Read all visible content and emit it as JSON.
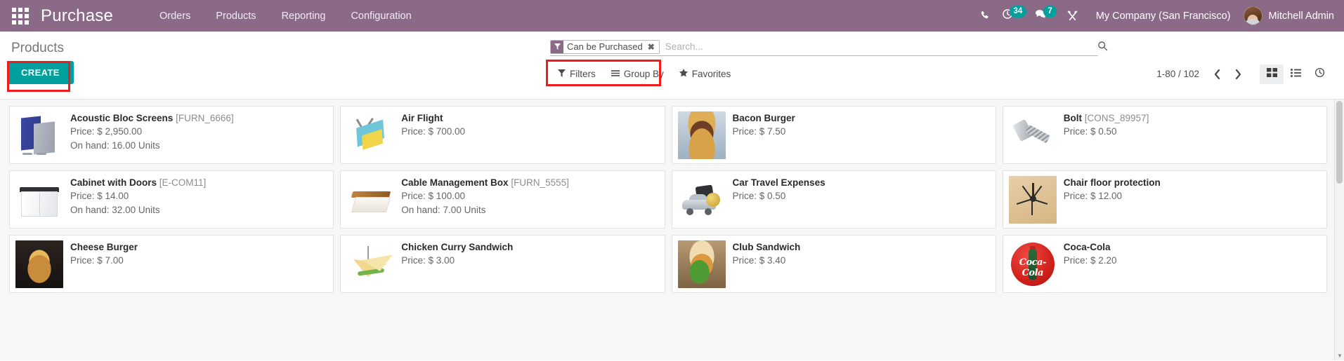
{
  "navbar": {
    "apps_icon": "apps-grid-icon",
    "brand": "Purchase",
    "menu": [
      {
        "label": "Orders"
      },
      {
        "label": "Products"
      },
      {
        "label": "Reporting"
      },
      {
        "label": "Configuration"
      }
    ],
    "systray": {
      "phone_icon": "phone-icon",
      "activity_icon": "clock-icon",
      "activity_count": "34",
      "messaging_icon": "chat-icon",
      "messaging_count": "7",
      "tools_icon": "wrench-screwdriver-icon",
      "company": "My Company (San Francisco)",
      "user": "Mitchell Admin",
      "avatar": "user-avatar"
    },
    "accent_color": "#8a6a86",
    "badge_color": "#00a09d"
  },
  "control_panel": {
    "title": "Products",
    "create_label": "CREATE",
    "create_color": "#00a09d",
    "highlight_color": "#f01c1c",
    "search": {
      "facet_label": "Can be Purchased",
      "facet_icon": "filter-funnel-icon",
      "facet_remove_icon": "close-icon",
      "placeholder": "Search...",
      "value": "",
      "search_icon": "search-icon"
    },
    "dropdowns": [
      {
        "label": "Filters",
        "icon": "filter-funnel-icon"
      },
      {
        "label": "Group By",
        "icon": "hamburger-icon"
      },
      {
        "label": "Favorites",
        "icon": "star-icon"
      }
    ],
    "pager": {
      "value": "1-80 / 102",
      "previous_icon": "chevron-left-icon",
      "next_icon": "chevron-right-icon"
    },
    "views": [
      {
        "name": "kanban",
        "icon": "kanban-icon",
        "active": true
      },
      {
        "name": "list",
        "icon": "list-icon",
        "active": false
      },
      {
        "name": "activity",
        "icon": "clock-icon",
        "active": false
      }
    ]
  },
  "kanban": {
    "price_prefix": "Price: ",
    "onhand_prefix": "On hand: ",
    "cards": [
      {
        "name": "Acoustic Bloc Screens",
        "code": "[FURN_6666]",
        "price": "$ 2,950.00",
        "onhand": "16.00 Units",
        "thumb": "th-screen"
      },
      {
        "name": "Air Flight",
        "code": "",
        "price": "$ 700.00",
        "onhand": "",
        "thumb": "th-flight"
      },
      {
        "name": "Bacon Burger",
        "code": "",
        "price": "$ 7.50",
        "onhand": "",
        "thumb": "th-photo th-bacon"
      },
      {
        "name": "Bolt",
        "code": "[CONS_89957]",
        "price": "$ 0.50",
        "onhand": "",
        "thumb": "th-bolt"
      },
      {
        "name": "Cabinet with Doors",
        "code": "[E-COM11]",
        "price": "$ 14.00",
        "onhand": "32.00 Units",
        "thumb": "th-cabinet"
      },
      {
        "name": "Cable Management Box",
        "code": "[FURN_5555]",
        "price": "$ 100.00",
        "onhand": "7.00 Units",
        "thumb": "th-cable"
      },
      {
        "name": "Car Travel Expenses",
        "code": "",
        "price": "$ 0.50",
        "onhand": "",
        "thumb": "th-car"
      },
      {
        "name": "Chair floor protection",
        "code": "",
        "price": "$ 12.00",
        "onhand": "",
        "thumb": "th-photo th-chair"
      },
      {
        "name": "Cheese Burger",
        "code": "",
        "price": "$ 7.00",
        "onhand": "",
        "thumb": "th-photo th-cheese"
      },
      {
        "name": "Chicken Curry Sandwich",
        "code": "",
        "price": "$ 3.00",
        "onhand": "",
        "thumb": "th-sandwich"
      },
      {
        "name": "Club Sandwich",
        "code": "",
        "price": "$ 3.40",
        "onhand": "",
        "thumb": "th-photo th-club"
      },
      {
        "name": "Coca-Cola",
        "code": "",
        "price": "$ 2.20",
        "onhand": "",
        "thumb": "th-coke",
        "logo_text": "Coca-Cola"
      }
    ]
  }
}
